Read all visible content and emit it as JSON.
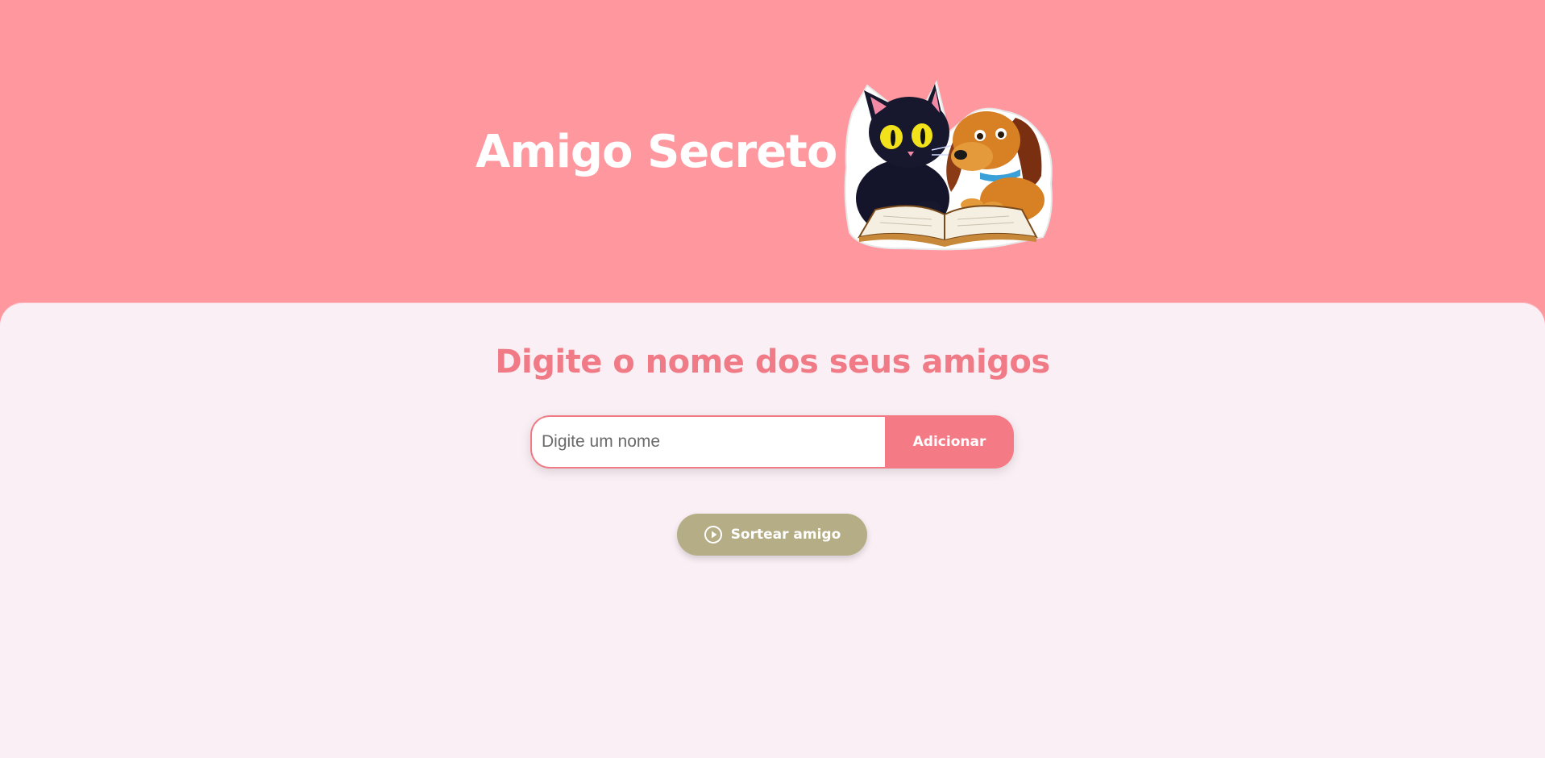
{
  "header": {
    "title": "Amigo Secreto",
    "illustration": "cat-and-dog-reading-book"
  },
  "main": {
    "subtitle": "Digite o nome dos seus amigos",
    "name_input": {
      "value": "",
      "placeholder": "Digite um nome"
    },
    "add_button_label": "Adicionar",
    "draw_button_label": "Sortear amigo",
    "draw_button_icon": "play-circle-icon"
  },
  "colors": {
    "header_bg": "#ff979f",
    "main_bg": "#f9eff4",
    "accent": "#f07b86",
    "draw_button_bg": "#b5ad85"
  }
}
